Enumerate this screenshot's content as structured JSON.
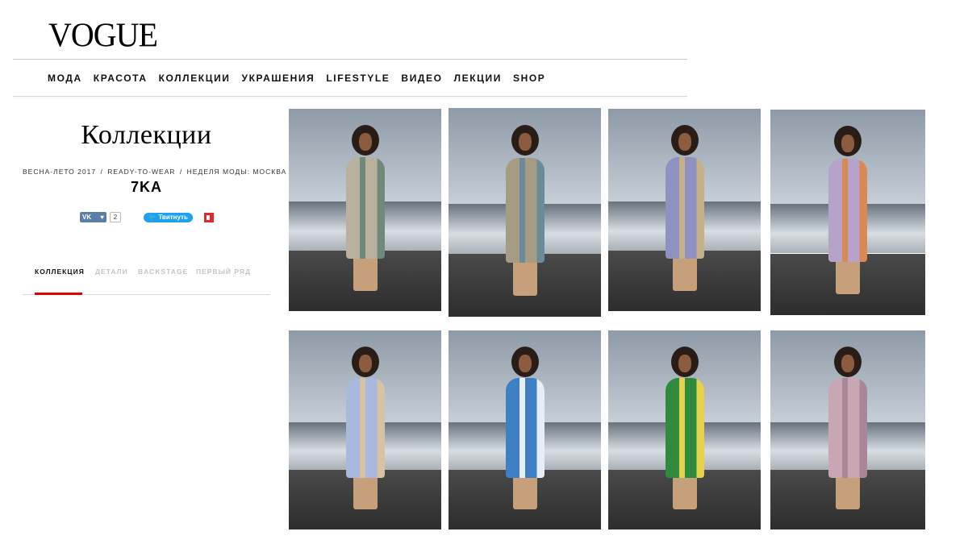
{
  "brand": {
    "logo": "VOGUE"
  },
  "nav": [
    "МОДА",
    "КРАСОТА",
    "КОЛЛЕКЦИИ",
    "УКРАШЕНИЯ",
    "LIFESTYLE",
    "ВИДЕО",
    "ЛЕКЦИИ",
    "SHOP"
  ],
  "sidebar": {
    "title": "Коллекции",
    "meta": {
      "season": "ВЕСНА-ЛЕТО 2017",
      "type": "READY-TO-WEAR",
      "event": "НЕДЕЛЯ МОДЫ: МОСКВА"
    },
    "designer": "7KA"
  },
  "share": {
    "vk_label": "VK",
    "vk_count": "2",
    "tweet_label": "Твитнуть",
    "icons": [
      "vk-icon",
      "heart-icon",
      "twitter-icon",
      "flipboard-icon"
    ]
  },
  "tabs": [
    {
      "label": "КОЛЛЕКЦИЯ",
      "active": true
    },
    {
      "label": "ДЕТАЛИ",
      "active": false
    },
    {
      "label": "BACKSTAGE",
      "active": false
    },
    {
      "label": "ПЕРВЫЙ РЯД",
      "active": false
    }
  ],
  "colors": {
    "accent": "#e00000",
    "vk": "#5b7fa6",
    "twitter": "#1da1f2",
    "flipboard": "#e12828"
  },
  "gallery": [
    {
      "name": "look-1",
      "coat": "#b9b19e",
      "stripe": "#6f8a7a"
    },
    {
      "name": "look-2",
      "coat": "#a69c86",
      "stripe": "#6b8a9a"
    },
    {
      "name": "look-3",
      "coat": "#8f92c0",
      "stripe": "#c4b089"
    },
    {
      "name": "look-4",
      "coat": "#b7a2c9",
      "stripe": "#d98a52"
    },
    {
      "name": "look-5",
      "coat": "#a9b8df",
      "stripe": "#d7c3a3"
    },
    {
      "name": "look-6",
      "coat": "#3f7fc4",
      "stripe": "#e8eef6"
    },
    {
      "name": "look-7",
      "coat": "#2f8a3e",
      "stripe": "#e6d24a"
    },
    {
      "name": "look-8",
      "coat": "#c9a6b4",
      "stripe": "#a88799"
    }
  ]
}
